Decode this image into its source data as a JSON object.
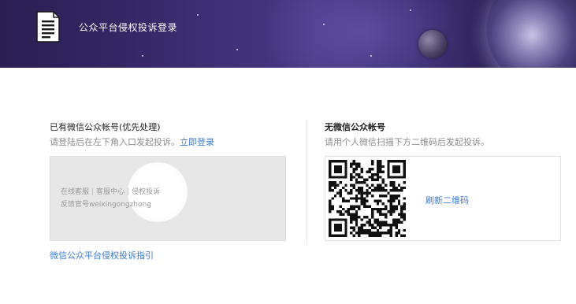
{
  "header": {
    "title": "公众平台侵权投诉登录",
    "logo_icon": "document-icon"
  },
  "left": {
    "title": "已有微信公众帐号(优先处理)",
    "desc": "请登陆后在左下角入口发起投诉。",
    "login_link": "立即登录",
    "preview": {
      "items": [
        "在线客服",
        "客服中心",
        "侵权投诉"
      ],
      "account_line": "反馈官号weixingongzhong"
    },
    "guide_link": "微信公众平台侵权投诉指引"
  },
  "right": {
    "title": "无微信公众帐号",
    "desc": "请用个人微信扫描下方二维码后发起投诉。",
    "qr_icon": "qr-code-icon",
    "refresh_link": "刷新二维码"
  },
  "colors": {
    "link": "#3c7bd2",
    "banner": "#3a2a6e"
  }
}
